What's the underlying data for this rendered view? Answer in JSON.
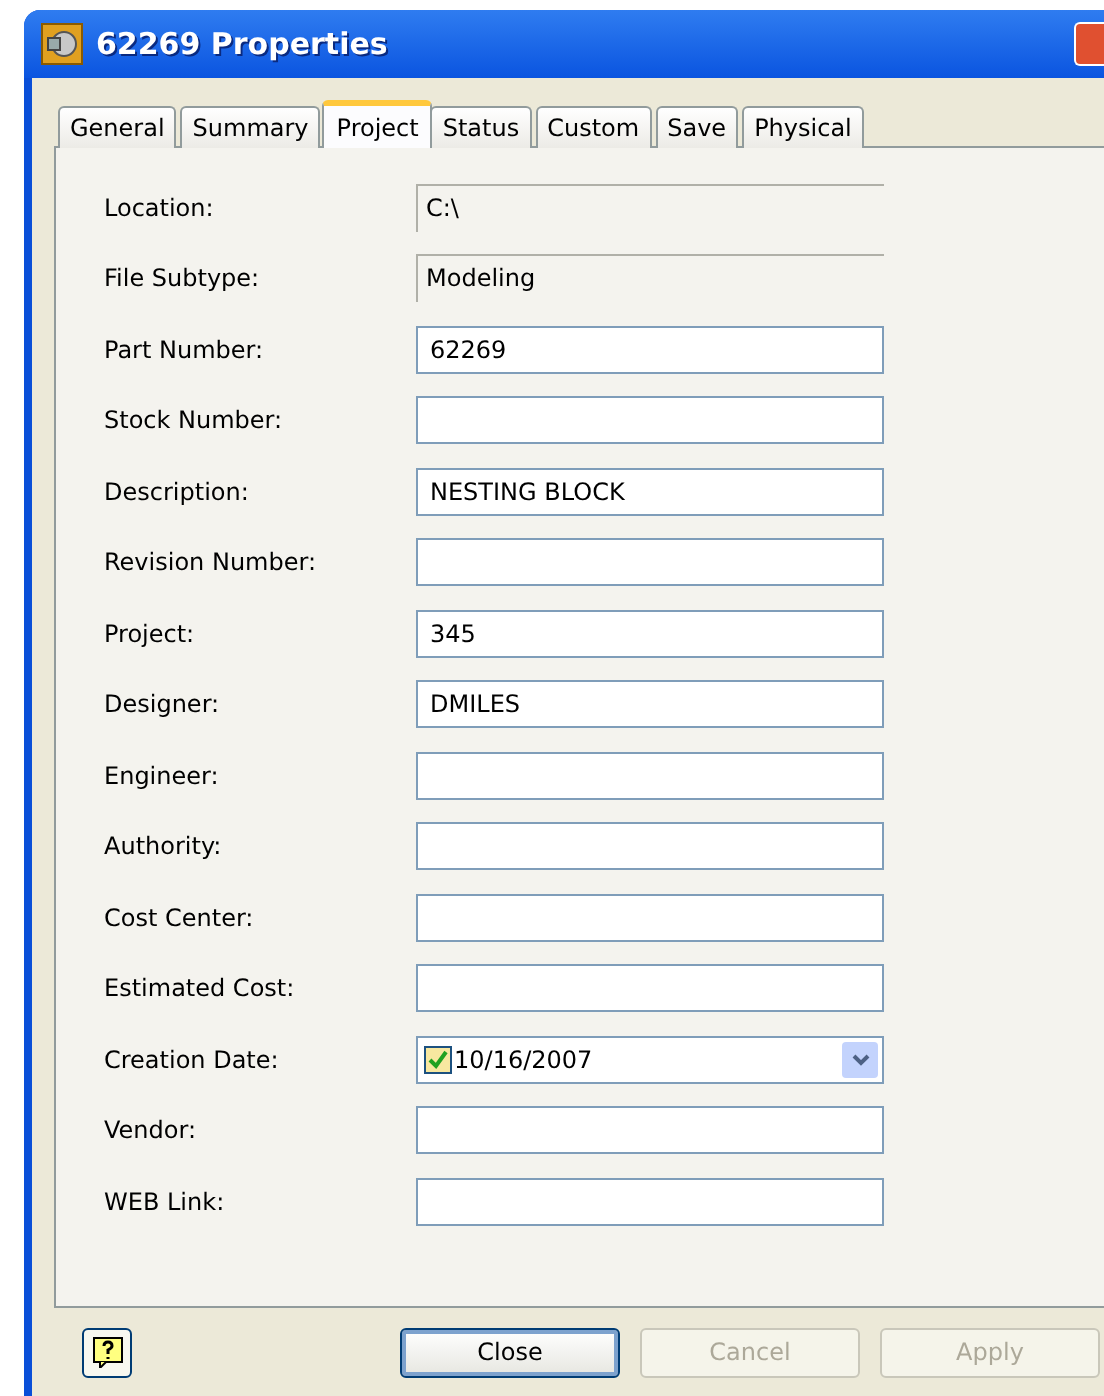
{
  "window": {
    "title": "62269 Properties"
  },
  "tabs": [
    {
      "label": "General",
      "selected": false
    },
    {
      "label": "Summary",
      "selected": false
    },
    {
      "label": "Project",
      "selected": true
    },
    {
      "label": "Status",
      "selected": false
    },
    {
      "label": "Custom",
      "selected": false
    },
    {
      "label": "Save",
      "selected": false
    },
    {
      "label": "Physical",
      "selected": false
    }
  ],
  "fields": [
    {
      "label": "Location:",
      "kind": "readonly",
      "value": "C:\\"
    },
    {
      "label": "File Subtype:",
      "kind": "readonly",
      "value": "Modeling"
    },
    {
      "label": "Part Number:",
      "kind": "text",
      "value": "62269"
    },
    {
      "label": "Stock Number:",
      "kind": "text"
    },
    {
      "label": "Description:",
      "kind": "text",
      "value": "NESTING BLOCK"
    },
    {
      "label": "Revision Number:",
      "kind": "text"
    },
    {
      "label": "Project:",
      "kind": "text",
      "value": "345"
    },
    {
      "label": "Designer:",
      "kind": "text",
      "value": "DMILES"
    },
    {
      "label": "Engineer:",
      "kind": "text"
    },
    {
      "label": "Authority:",
      "kind": "text"
    },
    {
      "label": "Cost Center:",
      "kind": "text"
    },
    {
      "label": "Estimated Cost:",
      "kind": "text"
    },
    {
      "label": "Creation Date:",
      "kind": "date",
      "value": "10/16/2007",
      "checked": true
    },
    {
      "label": "Vendor:",
      "kind": "text"
    },
    {
      "label": "WEB Link:",
      "kind": "text"
    }
  ],
  "buttons": [
    {
      "label": "Close",
      "disabled": false,
      "default": true
    },
    {
      "label": "Cancel",
      "disabled": true,
      "default": false
    },
    {
      "label": "Apply",
      "disabled": true,
      "default": false
    }
  ]
}
